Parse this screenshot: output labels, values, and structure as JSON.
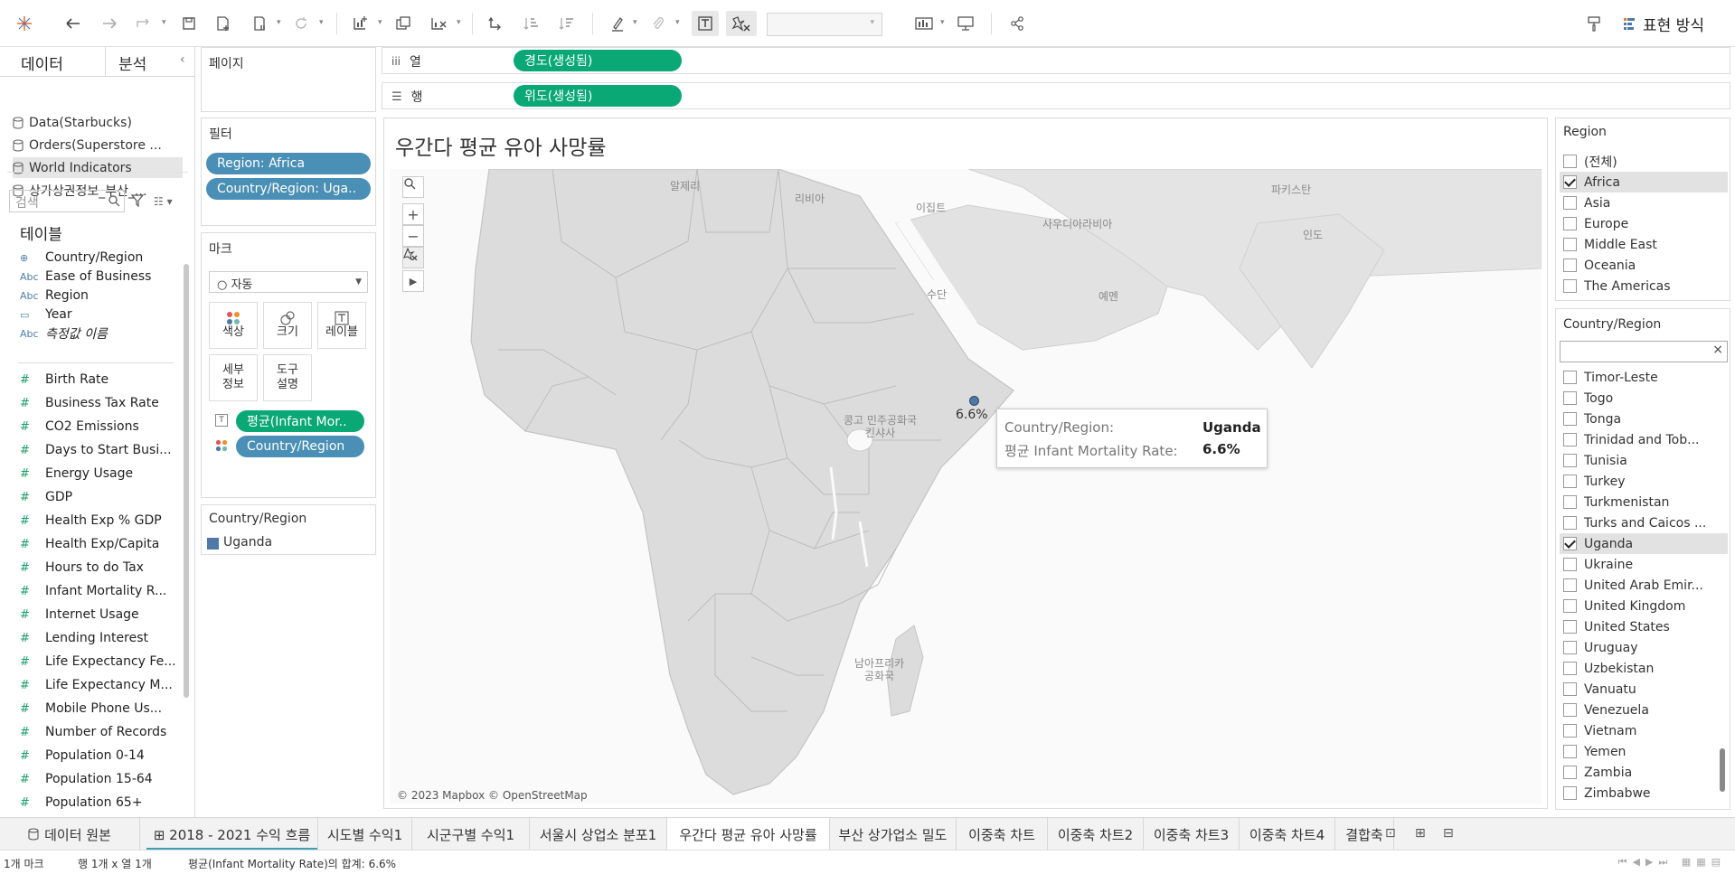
{
  "colors": {
    "accent_green": "#0aa875",
    "accent_blue": "#4a8fb5",
    "mark_color": "#4e79a7",
    "sheet_tab_underline": "#3ea0b0"
  },
  "toolbar": {
    "icons": [
      "tableau-logo-icon",
      "undo-icon",
      "redo-icon",
      "replay-icon",
      "save-icon",
      "new-data-source-icon",
      "pause-updates-icon",
      "refresh-icon",
      "new-worksheet-icon",
      "duplicate-sheet-icon",
      "clear-sheet-icon",
      "swap-rows-columns-icon",
      "sort-ascending-icon",
      "sort-descending-icon",
      "highlight-icon",
      "group-members-icon",
      "show-mark-labels-icon",
      "fix-axes-icon",
      "fit-select-icon",
      "card-visibility-icon",
      "presentation-mode-icon",
      "share-icon",
      "format-icon"
    ],
    "show_me_label": "표현 방식"
  },
  "left_pane": {
    "tab_data": "데이터",
    "tab_analysis": "분석",
    "collapse": "‹",
    "data_sources": [
      {
        "label": "Data(Starbucks)",
        "active": false
      },
      {
        "label": "Orders(Superstore ...",
        "active": false
      },
      {
        "label": "World Indicators",
        "active": true
      },
      {
        "label": "상가상권정보_부산_...",
        "active": false
      }
    ],
    "search_placeholder": "검색",
    "tables_title": "테이블",
    "dimensions": [
      {
        "icon": "globe-icon",
        "glyph": "⊕",
        "label": "Country/Region"
      },
      {
        "icon": "abc-icon",
        "glyph": "Abc",
        "label": "Ease of Business"
      },
      {
        "icon": "abc-icon",
        "glyph": "Abc",
        "label": "Region"
      },
      {
        "icon": "calendar-icon",
        "glyph": "▭",
        "label": "Year"
      },
      {
        "icon": "abc-icon",
        "glyph": "Abc",
        "label": "측정값 이름",
        "italic": true
      }
    ],
    "measures": [
      "Birth Rate",
      "Business Tax Rate",
      "CO2 Emissions",
      "Days to Start Busi...",
      "Energy Usage",
      "GDP",
      "Health Exp % GDP",
      "Health Exp/Capita",
      "Hours to do Tax",
      "Infant Mortality R...",
      "Internet Usage",
      "Lending Interest",
      "Life Expectancy Fe...",
      "Life Expectancy M...",
      "Mobile Phone Us...",
      "Number of Records",
      "Population 0-14",
      "Population 15-64",
      "Population 65+"
    ]
  },
  "pages_card": {
    "title": "페이지"
  },
  "filters_card": {
    "title": "필터",
    "pills": [
      "Region: Africa",
      "Country/Region: Uga.."
    ]
  },
  "marks_card": {
    "title": "마크",
    "mark_type": "○ 자동",
    "buttons": {
      "color": "색상",
      "size": "크기",
      "label": "레이블",
      "detail_1": "세부",
      "detail_2": "정보",
      "tooltip_1": "도구",
      "tooltip_2": "설명"
    },
    "pills": [
      "평균(Infant Mor..",
      "Country/Region"
    ]
  },
  "legend_card": {
    "title": "Country/Region",
    "item": "Uganda"
  },
  "shelves": {
    "columns_label": "열",
    "columns_pill": "경도(생성됨)",
    "rows_label": "행",
    "rows_pill": "위도(생성됨)"
  },
  "view": {
    "title": "우간다 평균 유아 사망률",
    "map_labels": {
      "algeria": "알제리",
      "libya": "리비아",
      "egypt": "이집트",
      "saudi": "사우디아라비아",
      "pakistan": "파키스탄",
      "india": "인도",
      "sudan": "수단",
      "yemen": "예멘",
      "congo_1": "콩고 민주공화국",
      "congo_2": "킨샤사",
      "sa_1": "남아프리카",
      "sa_2": "공화국"
    },
    "copyright": "© 2023 Mapbox © OpenStreetMap",
    "mark_label": "6.6%",
    "tooltip": {
      "k1": "Country/Region:",
      "v1": "Uganda",
      "k2": "평균 Infant Mortality Rate:",
      "v2": "6.6%"
    }
  },
  "region_filter": {
    "title": "Region",
    "items": [
      {
        "label": "(전체)",
        "checked": false
      },
      {
        "label": "Africa",
        "checked": true
      },
      {
        "label": "Asia",
        "checked": false
      },
      {
        "label": "Europe",
        "checked": false
      },
      {
        "label": "Middle East",
        "checked": false
      },
      {
        "label": "Oceania",
        "checked": false
      },
      {
        "label": "The Americas",
        "checked": false
      }
    ]
  },
  "country_filter": {
    "title": "Country/Region",
    "clear": "×",
    "items": [
      {
        "label": "Timor-Leste",
        "checked": false
      },
      {
        "label": "Togo",
        "checked": false
      },
      {
        "label": "Tonga",
        "checked": false
      },
      {
        "label": "Trinidad and Tob...",
        "checked": false
      },
      {
        "label": "Tunisia",
        "checked": false
      },
      {
        "label": "Turkey",
        "checked": false
      },
      {
        "label": "Turkmenistan",
        "checked": false
      },
      {
        "label": "Turks and Caicos ...",
        "checked": false
      },
      {
        "label": "Uganda",
        "checked": true
      },
      {
        "label": "Ukraine",
        "checked": false
      },
      {
        "label": "United Arab Emir...",
        "checked": false
      },
      {
        "label": "United Kingdom",
        "checked": false
      },
      {
        "label": "United States",
        "checked": false
      },
      {
        "label": "Uruguay",
        "checked": false
      },
      {
        "label": "Uzbekistan",
        "checked": false
      },
      {
        "label": "Vanuatu",
        "checked": false
      },
      {
        "label": "Venezuela",
        "checked": false
      },
      {
        "label": "Vietnam",
        "checked": false
      },
      {
        "label": "Yemen",
        "checked": false
      },
      {
        "label": "Zambia",
        "checked": false
      },
      {
        "label": "Zimbabwe",
        "checked": false
      }
    ]
  },
  "sheet_tabs": {
    "data_source": "데이터 원본",
    "tabs": [
      {
        "label": "⊞ 2018 - 2021 수익 흐름",
        "active": false,
        "underlined": true
      },
      {
        "label": "시도별 수익1",
        "active": false
      },
      {
        "label": "시군구별 수익1",
        "active": false
      },
      {
        "label": "서울시 상업소 분포1",
        "active": false
      },
      {
        "label": "우간다 평균 유아 사망률",
        "active": true
      },
      {
        "label": "부산 상가업소 밀도",
        "active": false
      },
      {
        "label": "이중축 차트",
        "active": false
      },
      {
        "label": "이중축 차트2",
        "active": false
      },
      {
        "label": "이중축 차트3",
        "active": false
      },
      {
        "label": "이중축 차트4",
        "active": false
      },
      {
        "label": "결합축",
        "active": false
      }
    ]
  },
  "status_bar": {
    "marks": "1개 마크",
    "rows_cols": "행 1개 x 열 1개",
    "sum": "평균(Infant Mortality Rate)의 합계: 6.6%"
  }
}
